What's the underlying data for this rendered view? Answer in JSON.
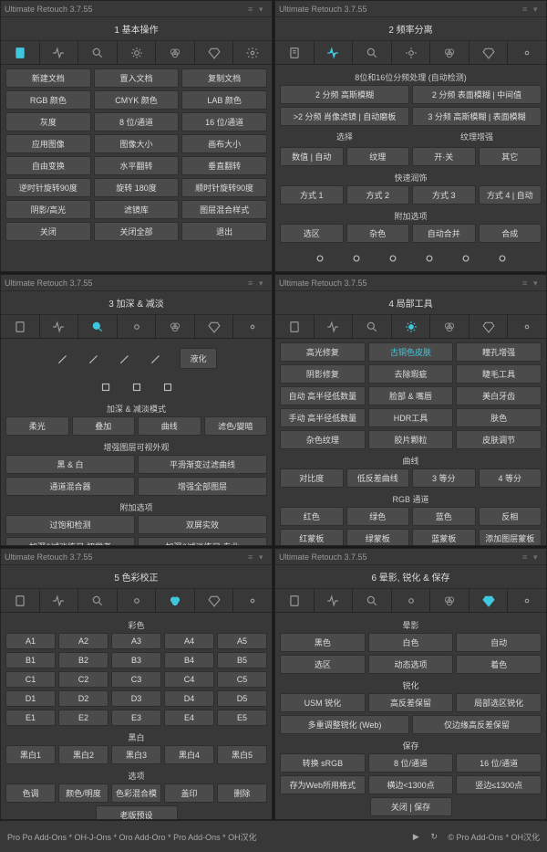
{
  "app_title": "Ultimate Retouch 3.7.55",
  "panels": {
    "p1": {
      "title": "1 基本操作",
      "rows": [
        [
          "新建文档",
          "置入文档",
          "复制文档"
        ],
        [
          "RGB 颜色",
          "CMYK 颜色",
          "LAB 颜色"
        ],
        [
          "灰度",
          "8 位/通道",
          "16 位/通道"
        ],
        [
          "应用图像",
          "图像大小",
          "画布大小"
        ],
        [
          "自由变换",
          "水平翻转",
          "垂直翻转"
        ],
        [
          "逆时针旋转90度",
          "旋转 180度",
          "顺时针旋转90度"
        ],
        [
          "阴影/高光",
          "滤镜库",
          "图层混合样式"
        ],
        [
          "关闭",
          "关闭全部",
          "退出"
        ]
      ]
    },
    "p2": {
      "title": "2 频率分离",
      "header1": "8位和16位分频处理 (自动检测)",
      "sec1": [
        [
          "2 分频 高斯模糊",
          "2 分频 表面模糊 | 中间值"
        ],
        [
          ">2 分频 肖像滤镜 | 自动磨板",
          "3 分频 高斯模糊 | 表面模糊"
        ]
      ],
      "sec2_labels": [
        "选择",
        "纹理增强"
      ],
      "sec2_rows": [
        [
          "数值 | 自动",
          "纹理",
          "开·关",
          "其它"
        ]
      ],
      "header2": "快速润饰",
      "sec3": [
        [
          "方式 1",
          "方式 2",
          "方式 3",
          "方式 4 | 自动"
        ]
      ],
      "header3": "附加选项",
      "sec4": [
        [
          "选区",
          "杂色",
          "自动合并",
          "合成"
        ]
      ]
    },
    "p3": {
      "title": "3 加深 & 减淡",
      "liquify": "液化",
      "header1": "加深 & 减淡模式",
      "sec1": [
        [
          "柔光",
          "叠加",
          "曲线",
          "滤色/變暗"
        ]
      ],
      "header2": "增强图层可视外观",
      "sec2": [
        [
          "黑 & 白",
          "平滑渐变过滤曲线"
        ],
        [
          "通道混合器",
          "增强全部图层"
        ]
      ],
      "header3": "附加选项",
      "sec3": [
        [
          "过饱和检测",
          "双屏实效"
        ],
        [
          "加深&减淡练习-初学者",
          "加深&减淡练习-专业"
        ]
      ]
    },
    "p4": {
      "title": "4 局部工具",
      "sec1": [
        [
          "高光修复",
          "古铜色皮肤",
          "瞳孔增强"
        ],
        [
          "阴影修复",
          "去除瑕疵",
          "睫毛工具"
        ],
        [
          "自动 高半径低数量",
          "脸部 & 嘴唇",
          "美白牙齿"
        ],
        [
          "手动 高半径低数量",
          "HDR工具",
          "肤色"
        ],
        [
          "杂色纹理",
          "胶片颗粒",
          "皮肤调节"
        ]
      ],
      "header1": "曲线",
      "sec2": [
        [
          "对比度",
          "低反差曲线",
          "3 等分",
          "4 等分"
        ]
      ],
      "header2": "RGB 通道",
      "sec3": [
        [
          "红色",
          "绿色",
          "蓝色",
          "反相"
        ],
        [
          "红蒙板",
          "绿蒙板",
          "蓝蒙板",
          "添加图层蒙板"
        ]
      ]
    },
    "p5": {
      "title": "5 色彩校正",
      "header1": "彩色",
      "color_rows": [
        [
          "A1",
          "A2",
          "A3",
          "A4",
          "A5"
        ],
        [
          "B1",
          "B2",
          "B3",
          "B4",
          "B5"
        ],
        [
          "C1",
          "C2",
          "C3",
          "C4",
          "C5"
        ],
        [
          "D1",
          "D2",
          "D3",
          "D4",
          "D5"
        ],
        [
          "E1",
          "E2",
          "E3",
          "E4",
          "E5"
        ]
      ],
      "header2": "黑白",
      "bw_rows": [
        [
          "黑白1",
          "黑白2",
          "黑白3",
          "黑白4",
          "黑白5"
        ]
      ],
      "header3": "选项",
      "opt_rows": [
        [
          "色调",
          "颜色/明度",
          "色彩混合模",
          "盖印",
          "删除"
        ]
      ],
      "footer_btn": "老版预设"
    },
    "p6": {
      "title": "6 晕影, 锐化 & 保存",
      "header1": "晕影",
      "sec1": [
        [
          "黑色",
          "白色",
          "自动"
        ],
        [
          "选区",
          "动态选项",
          "着色"
        ]
      ],
      "header2": "锐化",
      "sec2": [
        [
          "USM 锐化",
          "高反差保留",
          "局部选区锐化"
        ],
        [
          "多重调整锐化 (Web)",
          "仅边缘高反差保留"
        ]
      ],
      "header3": "保存",
      "sec3": [
        [
          "转换 sRGB",
          "8 位/通道",
          "16 位/通道"
        ],
        [
          "存为Web所用格式",
          "横边<1300点",
          "竖边≤1300点"
        ]
      ],
      "footer_btn": "关闭 | 保存"
    }
  },
  "footer": {
    "left": "Pro Po Add-Ons * OH-J-Ons * Oro Add-Oro * Pro Add-Ons * OH汉化",
    "right": "© Pro Add-Ons * OH汉化"
  },
  "chart_data": null
}
